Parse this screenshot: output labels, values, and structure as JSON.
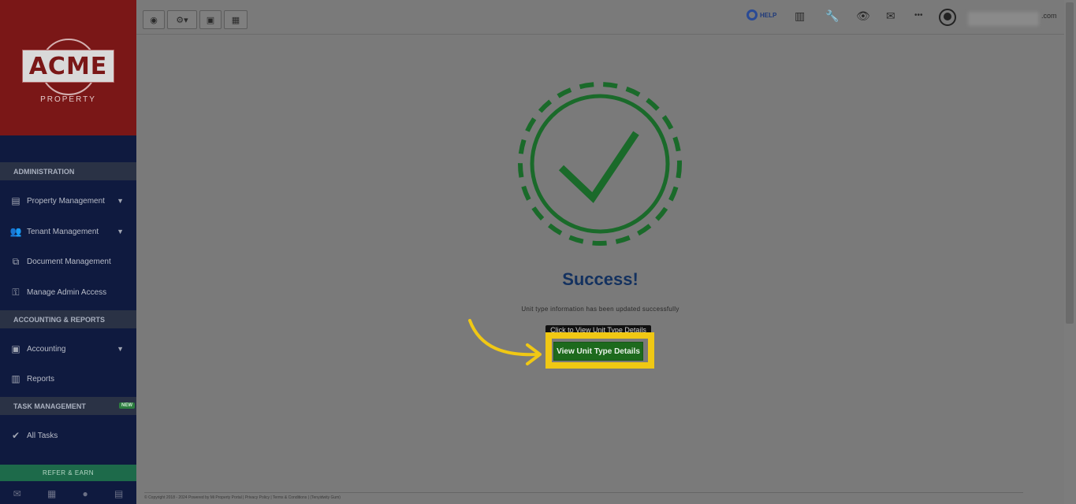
{
  "brand": {
    "name": "ACME",
    "sub": "PROPERTY"
  },
  "sidebar": {
    "sections": [
      {
        "label": "ADMINISTRATION"
      },
      {
        "label": "ACCOUNTING & REPORTS"
      },
      {
        "label": "TASK MANAGEMENT",
        "badge": "NEW"
      }
    ],
    "items": [
      {
        "label": "Property Management",
        "icon": "building-icon",
        "has_chevron": true
      },
      {
        "label": "Tenant Management",
        "icon": "users-icon",
        "has_chevron": true
      },
      {
        "label": "Document Management",
        "icon": "documents-icon",
        "has_chevron": false
      },
      {
        "label": "Manage Admin Access",
        "icon": "key-icon",
        "has_chevron": false
      },
      {
        "label": "Accounting",
        "icon": "money-icon",
        "has_chevron": true
      },
      {
        "label": "Reports",
        "icon": "bar-chart-icon",
        "has_chevron": false
      },
      {
        "label": "All Tasks",
        "icon": "check-icon",
        "has_chevron": false
      }
    ],
    "refer_label": "REFER & EARN",
    "bottom_icons": [
      "mail-icon",
      "briefcase-icon",
      "user-icon",
      "calculator-icon"
    ]
  },
  "topbar": {
    "left_buttons": [
      "dashboard-icon",
      "gear-icon",
      "calendar-icon",
      "calculator-icon"
    ],
    "help_label": "HELP",
    "right_icons": [
      "bar-chart-icon",
      "wrench-icon",
      "eye-icon",
      "mail-icon",
      "more-icon"
    ],
    "user_email_suffix": ".com"
  },
  "main": {
    "title": "Success!",
    "message": "Unit type information has been updated successfully",
    "tooltip": "Click to View Unit Type Details",
    "button_label": "View Unit Type Details"
  },
  "footer": {
    "text": "© Copyright 2018 - 2024 Powered by Mi Property Portal | Privacy Policy | Terms & Conditions | (Tenyidwity Gum)"
  },
  "colors": {
    "sidebar_bg": "#0f1a3f",
    "logo_bg": "#7a1717",
    "success_green": "#1d6a1d",
    "highlight": "#f0c814",
    "title": "#13315f"
  }
}
